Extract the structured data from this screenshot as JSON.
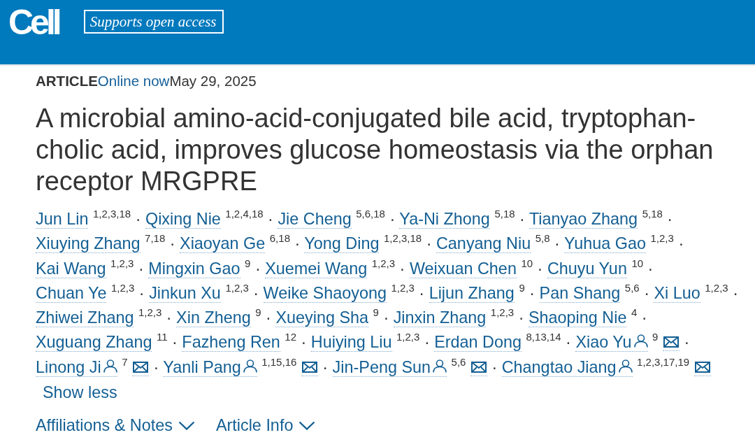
{
  "header": {
    "logo": "Cell",
    "badge": "Supports open access"
  },
  "article": {
    "type_label": "ARTICLE",
    "status": "Online now",
    "date": "May 29, 2025",
    "title": "A microbial amino-acid-conjugated bile acid, tryptophan-cholic acid, improves glucose homeostasis via the orphan receptor MRGPRE",
    "authors": [
      {
        "name": "Jun Lin",
        "affiliations": "1,2,3,18",
        "corresponding": false,
        "separator": "·"
      },
      {
        "name": "Qixing Nie",
        "affiliations": "1,2,4,18",
        "corresponding": false,
        "separator": "·"
      },
      {
        "name": "Jie Cheng",
        "affiliations": "5,6,18",
        "corresponding": false,
        "separator": "·"
      },
      {
        "name": "Ya-Ni Zhong",
        "affiliations": "5,18",
        "corresponding": false,
        "separator": "·"
      },
      {
        "name": "Tianyao Zhang",
        "affiliations": "5,18",
        "corresponding": false,
        "separator": "·"
      },
      {
        "name": "Xiuying Zhang",
        "affiliations": "7,18",
        "corresponding": false,
        "separator": "·"
      },
      {
        "name": "Xiaoyan Ge",
        "affiliations": "6,18",
        "corresponding": false,
        "separator": "·"
      },
      {
        "name": "Yong Ding",
        "affiliations": "1,2,3,18",
        "corresponding": false,
        "separator": "·"
      },
      {
        "name": "Canyang Niu",
        "affiliations": "5,8",
        "corresponding": false,
        "separator": "·"
      },
      {
        "name": "Yuhua Gao",
        "affiliations": "1,2,3",
        "corresponding": false,
        "separator": "·"
      },
      {
        "name": "Kai Wang",
        "affiliations": "1,2,3",
        "corresponding": false,
        "separator": "·"
      },
      {
        "name": "Mingxin Gao",
        "affiliations": "9",
        "corresponding": false,
        "separator": "·"
      },
      {
        "name": "Xuemei Wang",
        "affiliations": "1,2,3",
        "corresponding": false,
        "separator": "·"
      },
      {
        "name": "Weixuan Chen",
        "affiliations": "10",
        "corresponding": false,
        "separator": "·"
      },
      {
        "name": "Chuyu Yun",
        "affiliations": "10",
        "corresponding": false,
        "separator": "·"
      },
      {
        "name": "Chuan Ye",
        "affiliations": "1,2,3",
        "corresponding": false,
        "separator": "·"
      },
      {
        "name": "Jinkun Xu",
        "affiliations": "1,2,3",
        "corresponding": false,
        "separator": "·"
      },
      {
        "name": "Weike Shaoyong",
        "affiliations": "1,2,3",
        "corresponding": false,
        "separator": "·"
      },
      {
        "name": "Lijun Zhang",
        "affiliations": "9",
        "corresponding": false,
        "separator": "·"
      },
      {
        "name": "Pan Shang",
        "affiliations": "5,6",
        "corresponding": false,
        "separator": "·"
      },
      {
        "name": "Xi Luo",
        "affiliations": "1,2,3",
        "corresponding": false,
        "separator": "·"
      },
      {
        "name": "Zhiwei Zhang",
        "affiliations": "1,2,3",
        "corresponding": false,
        "separator": "·"
      },
      {
        "name": "Xin Zheng",
        "affiliations": "9",
        "corresponding": false,
        "separator": "·"
      },
      {
        "name": "Xueying Sha",
        "affiliations": "9",
        "corresponding": false,
        "separator": "·"
      },
      {
        "name": "Jinxin Zhang",
        "affiliations": "1,2,3",
        "corresponding": false,
        "separator": "·"
      },
      {
        "name": "Shaoping Nie",
        "affiliations": "4",
        "corresponding": false,
        "separator": "·"
      },
      {
        "name": "Xuguang Zhang",
        "affiliations": "11",
        "corresponding": false,
        "separator": "·"
      },
      {
        "name": "Fazheng Ren",
        "affiliations": "12",
        "corresponding": false,
        "separator": "·"
      },
      {
        "name": "Huiying Liu",
        "affiliations": "1,2,3",
        "corresponding": false,
        "separator": "·"
      },
      {
        "name": "Erdan Dong",
        "affiliations": "8,13,14",
        "corresponding": false,
        "separator": "·"
      },
      {
        "name": "Xiao Yu",
        "affiliations": "9",
        "corresponding": true,
        "separator": "·"
      },
      {
        "name": "Linong Ji",
        "affiliations": "7",
        "corresponding": true,
        "separator": "·"
      },
      {
        "name": "Yanli Pang",
        "affiliations": "1,15,16",
        "corresponding": true,
        "separator": "·"
      },
      {
        "name": "Jin-Peng Sun",
        "affiliations": "5,6",
        "corresponding": true,
        "separator": "·"
      },
      {
        "name": "Changtao Jiang",
        "affiliations": "1,2,3,17,19",
        "corresponding": true
      }
    ],
    "show_less": "Show less",
    "sections": [
      {
        "label": "Affiliations & Notes",
        "expanded": false
      },
      {
        "label": "Article Info",
        "expanded": false
      }
    ]
  }
}
